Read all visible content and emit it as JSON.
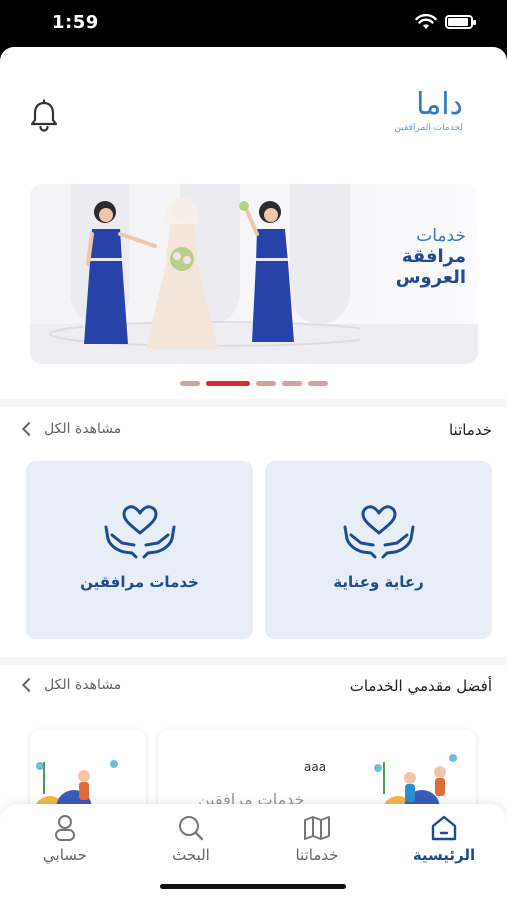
{
  "status": {
    "time": "1:59",
    "battery_level": 0.9
  },
  "header": {
    "logo_mark": "داما",
    "logo_tagline": "لخدمات المرافقين",
    "bell_icon": "bell-icon"
  },
  "banner": {
    "line1": "خدمات",
    "line2": "مرافقة",
    "line3": "العروس",
    "slide_count": 5,
    "active_slide": 2
  },
  "services_section": {
    "title": "خدماتنا",
    "see_all": "مشاهدة الكل",
    "cards": [
      {
        "label": "رعاية وعناية",
        "icon": "heart-hands-icon"
      },
      {
        "label": "خدمات مرافقين",
        "icon": "heart-hands-icon"
      }
    ]
  },
  "providers_section": {
    "title": "أفضل مقدمي الخدمات",
    "see_all": "مشاهدة الكل",
    "providers": [
      {
        "name": "aaa",
        "subtitle": "خدمات مرافقين"
      }
    ]
  },
  "tabbar": {
    "tabs": [
      {
        "label": "الرئيسية",
        "icon": "home-icon",
        "active": true
      },
      {
        "label": "خدماتنا",
        "icon": "map-icon",
        "active": false
      },
      {
        "label": "البحث",
        "icon": "search-icon",
        "active": false
      },
      {
        "label": "حسابي",
        "icon": "user-icon",
        "active": false
      }
    ]
  },
  "colors": {
    "primary": "#1d4c8f",
    "accent_red": "#d0312d",
    "card_bg": "#e7eef7"
  }
}
